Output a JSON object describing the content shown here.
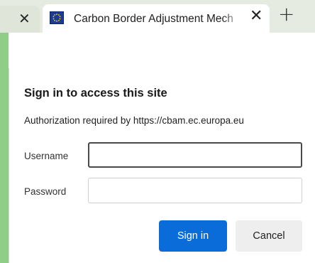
{
  "tabs": {
    "previous_tab": {
      "close_glyph": "✕"
    },
    "active_tab": {
      "favicon": "eu-flag-icon",
      "title": "Carbon Border Adjustment Mech",
      "close_glyph": "✕"
    },
    "new_tab_glyph": "+"
  },
  "dialog": {
    "title": "Sign in to access this site",
    "subtitle": "Authorization required by https://cbam.ec.europa.eu",
    "username_label": "Username",
    "username_value": "",
    "password_label": "Password",
    "password_value": "",
    "sign_in_label": "Sign in",
    "cancel_label": "Cancel"
  },
  "colors": {
    "background_frame": "#8fce86",
    "primary_button": "#0a6cd8",
    "secondary_button": "#eeeeee"
  }
}
